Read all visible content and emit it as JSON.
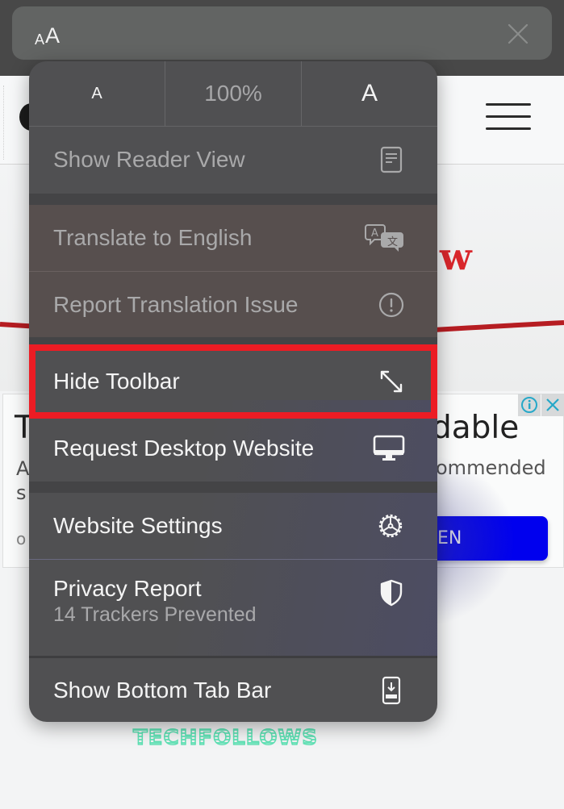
{
  "toolbar": {
    "aa_small": "A",
    "aa_large": "A",
    "close_icon": "close-icon"
  },
  "page": {
    "hero_letter": "w",
    "ad": {
      "title_left": "T",
      "title_right": "dable",
      "subtitle_left_1": "A",
      "subtitle_left_2": "s",
      "subtitle_right": "ommended",
      "small_left": "o",
      "cta_label": "EN",
      "info_icon": "info-icon",
      "close_icon": "close-icon"
    },
    "watermark": "TECHFOLLOWS"
  },
  "menu": {
    "font_size": {
      "decrease_label": "A",
      "zoom_level": "100%",
      "increase_label": "A"
    },
    "items": [
      {
        "label": "Show Reader View",
        "icon": "reader-view-icon",
        "enabled": false
      },
      {
        "label": "Translate to English",
        "icon": "translate-icon",
        "enabled": false
      },
      {
        "label": "Report Translation Issue",
        "icon": "exclamation-circle-icon",
        "enabled": false
      },
      {
        "label": "Hide Toolbar",
        "icon": "expand-arrows-icon",
        "enabled": true,
        "highlighted": true
      },
      {
        "label": "Request Desktop Website",
        "icon": "desktop-icon",
        "enabled": true
      },
      {
        "label": "Website Settings",
        "icon": "gear-icon",
        "enabled": true
      },
      {
        "label": "Privacy Report",
        "sublabel": "14 Trackers Prevented",
        "icon": "shield-icon",
        "enabled": true
      },
      {
        "label": "Show Bottom Tab Bar",
        "icon": "bottom-tab-bar-icon",
        "enabled": true
      }
    ]
  },
  "colors": {
    "highlight": "#ec1c24",
    "cta": "#0000ee",
    "brand_red": "#d9262b",
    "watermark": "#5fe0b4"
  }
}
